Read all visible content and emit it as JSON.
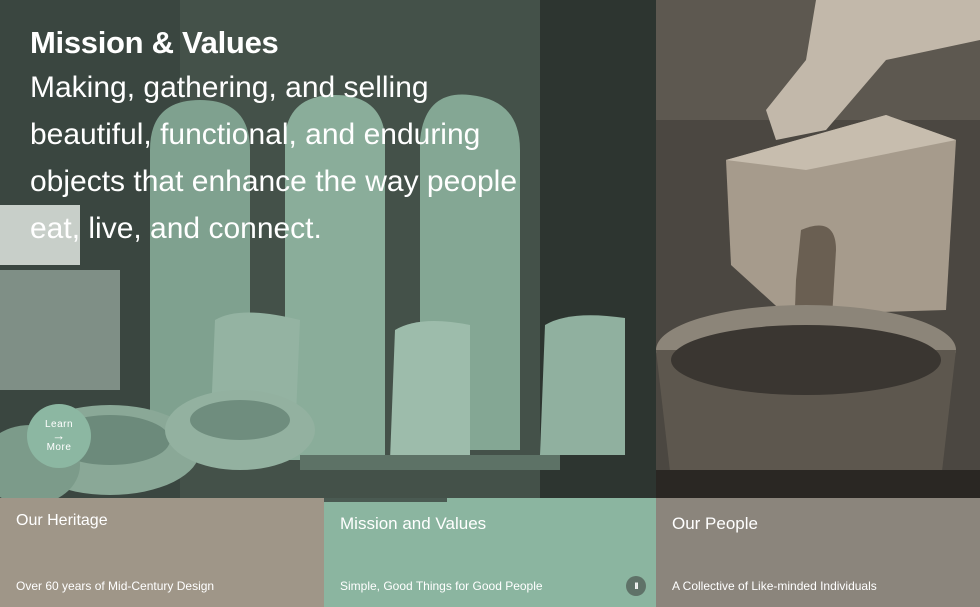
{
  "hero": {
    "title": "Mission & Values",
    "body": "Making, gathering, and selling beautiful, functional, and enduring objects that enhance the way people eat, live, and connect.",
    "learn_more_top": "Learn",
    "learn_more_arrow": "→",
    "learn_more_bottom": "More"
  },
  "tabs": [
    {
      "title": "Our Heritage",
      "subtitle": "Over 60 years of Mid-Century Design",
      "active": false
    },
    {
      "title": "Mission and Values",
      "subtitle": "Simple, Good Things for Good People",
      "active": true,
      "progress": 0.37
    },
    {
      "title": "Our People",
      "subtitle": "A Collective of Like-minded Individuals",
      "active": false
    }
  ],
  "controls": {
    "pause_icon": "pause-icon",
    "pause_label": "II"
  },
  "colors": {
    "heritage": "#9f9688",
    "mission": "#8bb5a0",
    "people": "#8b857c",
    "learn_more": "#8cb7a2"
  }
}
